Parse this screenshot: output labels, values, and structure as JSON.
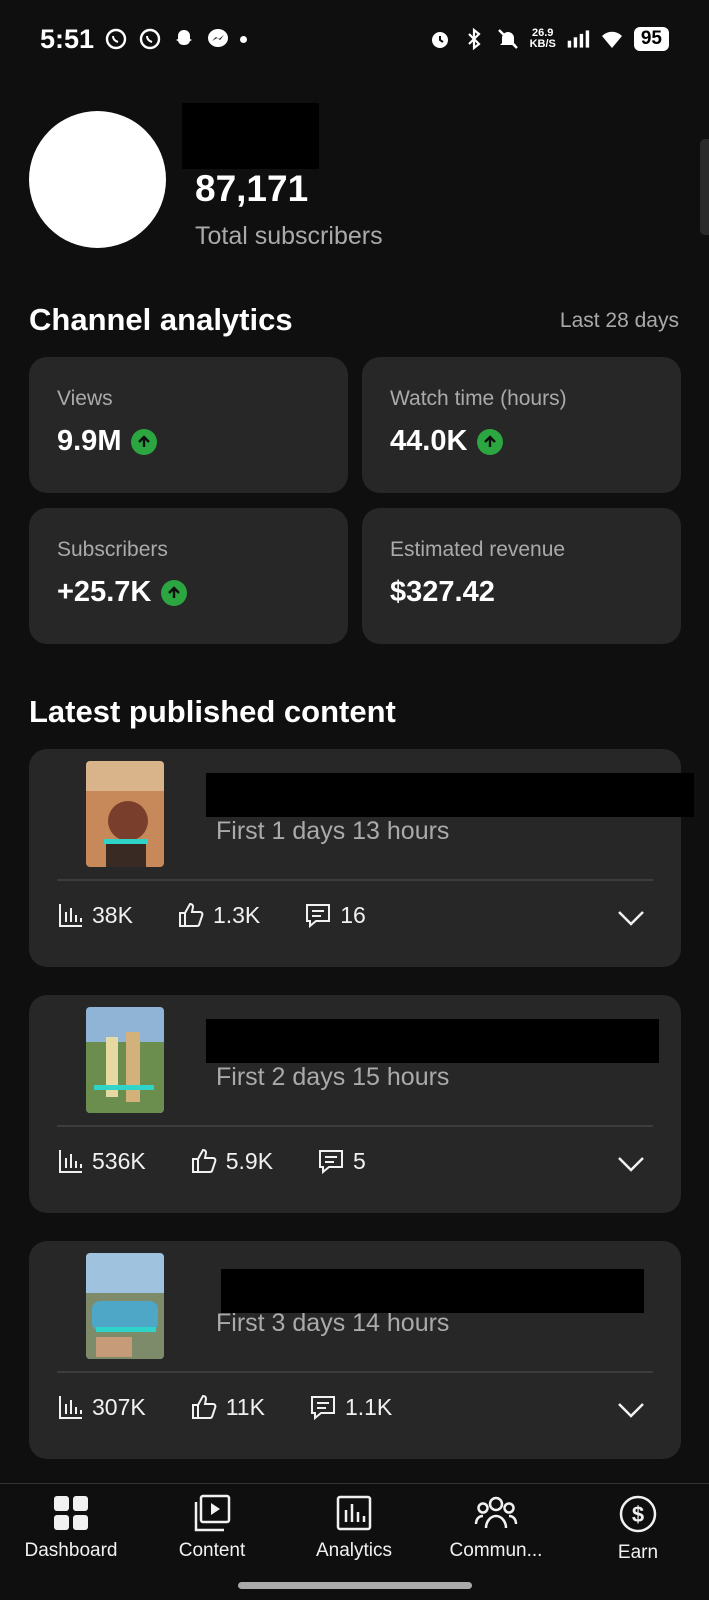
{
  "status_bar": {
    "time": "5:51",
    "net_speed_top": "26.9",
    "net_speed_bottom": "KB/S",
    "battery": "95"
  },
  "channel": {
    "subscriber_count": "87,171",
    "subscriber_label": "Total subscribers"
  },
  "analytics": {
    "title": "Channel analytics",
    "range": "Last 28 days",
    "stats": [
      {
        "label": "Views",
        "value": "9.9M",
        "trend": "up"
      },
      {
        "label": "Watch time (hours)",
        "value": "44.0K",
        "trend": "up"
      },
      {
        "label": "Subscribers",
        "value": "+25.7K",
        "trend": "up"
      },
      {
        "label": "Estimated revenue",
        "value": "$327.42",
        "trend": "none"
      }
    ],
    "trend_color": "#2ba640"
  },
  "latest": {
    "title": "Latest published content",
    "items": [
      {
        "age": "First 1 days 13 hours",
        "views": "38K",
        "likes": "1.3K",
        "comments": "16"
      },
      {
        "age": "First 2 days 15 hours",
        "views": "536K",
        "likes": "5.9K",
        "comments": "5"
      },
      {
        "age": "First 3 days 14 hours",
        "views": "307K",
        "likes": "11K",
        "comments": "1.1K"
      }
    ]
  },
  "nav": [
    {
      "label": "Dashboard",
      "icon": "dashboard-icon"
    },
    {
      "label": "Content",
      "icon": "content-icon"
    },
    {
      "label": "Analytics",
      "icon": "analytics-icon"
    },
    {
      "label": "Commun...",
      "icon": "community-icon"
    },
    {
      "label": "Earn",
      "icon": "earn-icon"
    }
  ]
}
